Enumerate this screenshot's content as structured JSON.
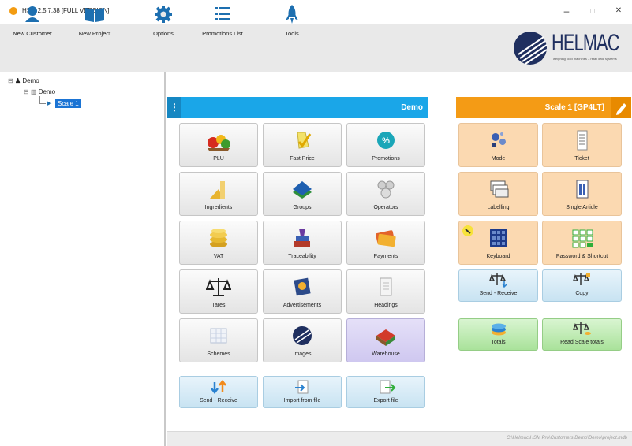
{
  "window": {
    "title": "HSM 2.5.7.38   [FULL VERSION]",
    "minimize": "–",
    "maximize": "□",
    "close": "✕"
  },
  "toolbar": {
    "items": [
      {
        "label": "New Customer",
        "icon": "user-icon"
      },
      {
        "label": "New Project",
        "icon": "book-icon"
      },
      {
        "label": "Options",
        "icon": "gear-icon"
      },
      {
        "label": "Promotions List",
        "icon": "list-icon"
      },
      {
        "label": "Tools",
        "icon": "rocket-icon"
      }
    ],
    "logo": "HELMAC",
    "logo_tagline": "weighing food machines – retail data systems",
    "brand_color": "#1f2f5f"
  },
  "tree": {
    "root": "Demo",
    "child": "Demo",
    "leaf": "Scale 1",
    "expand_root": "⊟",
    "expand_child": "⊟"
  },
  "demo_panel": {
    "title": "Demo",
    "menu_icon": "⋮",
    "color": "#1aa6e8",
    "buttons": [
      {
        "label": "PLU",
        "icon": "produce-icon"
      },
      {
        "label": "Fast Price",
        "icon": "fast-price-icon"
      },
      {
        "label": "Promotions",
        "icon": "percent-icon"
      },
      {
        "label": "Ingredients",
        "icon": "ingredients-icon"
      },
      {
        "label": "Groups",
        "icon": "groups-icon"
      },
      {
        "label": "Operators",
        "icon": "operators-icon"
      },
      {
        "label": "VAT",
        "icon": "coins-icon"
      },
      {
        "label": "Traceability",
        "icon": "traceability-icon"
      },
      {
        "label": "Payments",
        "icon": "cards-icon"
      },
      {
        "label": "Tares",
        "icon": "balance-icon"
      },
      {
        "label": "Advertisements",
        "icon": "advertisements-icon"
      },
      {
        "label": "Headings",
        "icon": "document-icon"
      },
      {
        "label": "Schemes",
        "icon": "scheme-icon"
      },
      {
        "label": "Images",
        "icon": "images-icon"
      },
      {
        "label": "Warehouse",
        "icon": "warehouse-icon"
      }
    ],
    "actions": [
      {
        "label": "Send - Receive",
        "icon": "send-receive-icon"
      },
      {
        "label": "Import from file",
        "icon": "import-icon"
      },
      {
        "label": "Export file",
        "icon": "export-icon"
      }
    ]
  },
  "scale_panel": {
    "title": "Scale 1 [GP4LT]",
    "edit_icon": "pencil-icon",
    "color": "#f49b15",
    "buttons": [
      {
        "label": "Mode",
        "icon": "mode-icon"
      },
      {
        "label": "Ticket",
        "icon": "ticket-icon"
      },
      {
        "label": "Labelling",
        "icon": "labels-icon"
      },
      {
        "label": "Single Article",
        "icon": "single-article-icon"
      },
      {
        "label": "Keyboard",
        "icon": "keyboard-icon"
      },
      {
        "label": "Password & Shortcut",
        "icon": "password-icon"
      }
    ],
    "actions": [
      {
        "label": "Send - Receive",
        "icon": "scale-send-icon"
      },
      {
        "label": "Copy",
        "icon": "scale-copy-icon"
      }
    ],
    "totals": [
      {
        "label": "Totals",
        "icon": "totals-icon"
      },
      {
        "label": "Read Scale totals",
        "icon": "read-totals-icon"
      }
    ]
  },
  "statusbar": {
    "path": "C:\\Helmac\\HSM Pro\\Customers\\Demo\\Demo\\project.mdb"
  }
}
